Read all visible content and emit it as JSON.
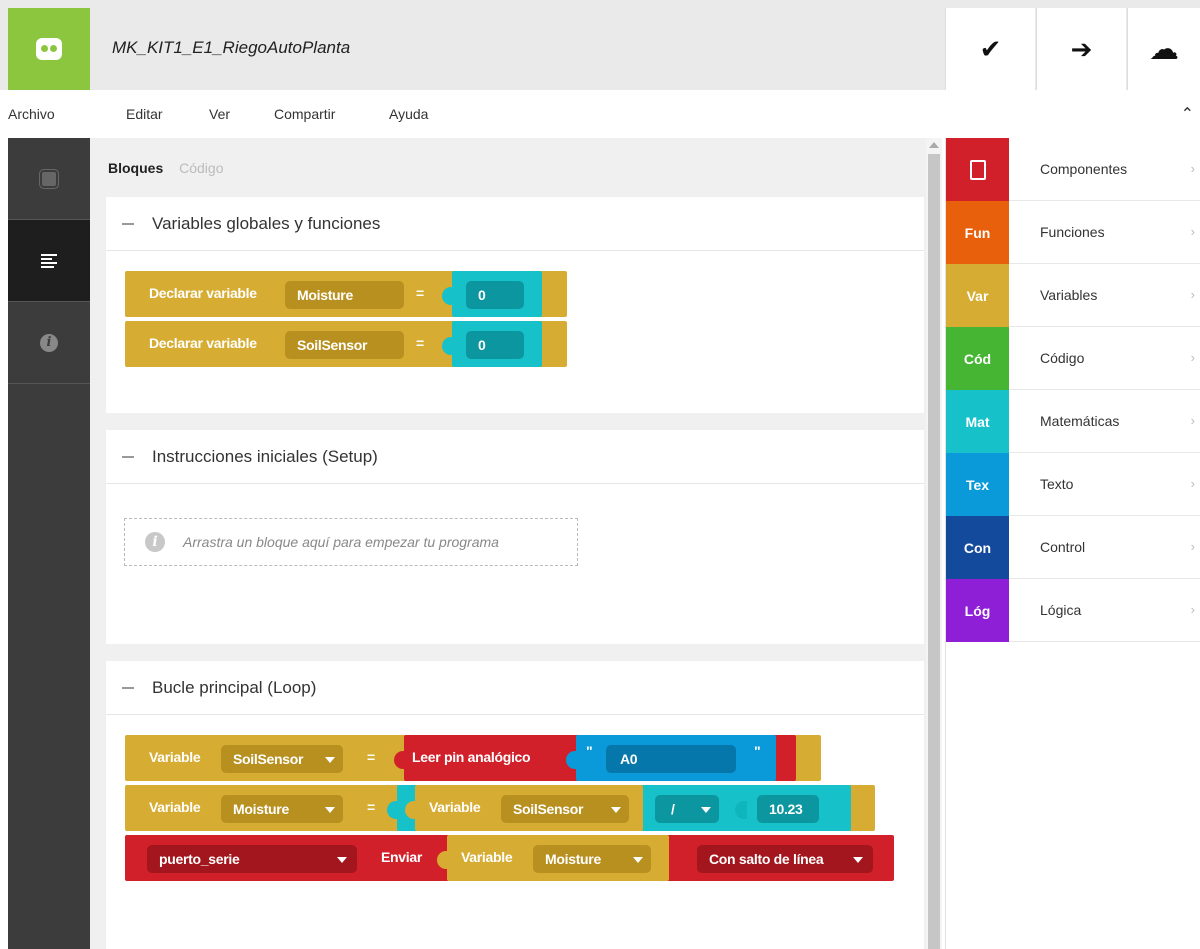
{
  "app": {
    "project_title": "MK_KIT1_E1_RiegoAutoPlanta"
  },
  "toolbar": {
    "verify_icon": "✔",
    "upload_icon": "➔",
    "cloud_icon": "☁"
  },
  "menu": {
    "items": [
      "Archivo",
      "Editar",
      "Ver",
      "Compartir",
      "Ayuda"
    ],
    "collapse_icon": "⌃"
  },
  "tabs": {
    "blocks": "Bloques",
    "code": "Código"
  },
  "sections": {
    "globals": "Variables globales y funciones",
    "setup": "Instrucciones iniciales (Setup)",
    "loop": "Bucle principal (Loop)"
  },
  "globals": [
    {
      "label": "Declarar variable",
      "name": "Moisture",
      "eq": "=",
      "value": "0"
    },
    {
      "label": "Declarar variable",
      "name": "SoilSensor",
      "eq": "=",
      "value": "0"
    }
  ],
  "setup_placeholder": "Arrastra un bloque aquí para empezar tu programa",
  "loop": {
    "row1": {
      "kw": "Variable",
      "var": "SoilSensor",
      "eq": "=",
      "fn": "Leer pin analógico",
      "pin": "A0",
      "quote": "\""
    },
    "row2": {
      "kw": "Variable",
      "var": "Moisture",
      "eq": "=",
      "inner_kw": "Variable",
      "inner_var": "SoilSensor",
      "op": "/",
      "num": "10.23"
    },
    "row3": {
      "port": "puerto_serie",
      "send": "Enviar",
      "kw": "Variable",
      "var": "Moisture",
      "mode": "Con salto de línea"
    }
  },
  "categories": [
    {
      "abbr": "",
      "name": "Componentes",
      "color": "#d2202a"
    },
    {
      "abbr": "Fun",
      "name": "Funciones",
      "color": "#e85f0c"
    },
    {
      "abbr": "Var",
      "name": "Variables",
      "color": "#d6ac32"
    },
    {
      "abbr": "Cód",
      "name": "Código",
      "color": "#46b534"
    },
    {
      "abbr": "Mat",
      "name": "Matemáticas",
      "color": "#16c1c9"
    },
    {
      "abbr": "Tex",
      "name": "Texto",
      "color": "#0a9ad9"
    },
    {
      "abbr": "Con",
      "name": "Control",
      "color": "#134a9c"
    },
    {
      "abbr": "Lóg",
      "name": "Lógica",
      "color": "#8f1fd6"
    }
  ],
  "chevron": "›"
}
